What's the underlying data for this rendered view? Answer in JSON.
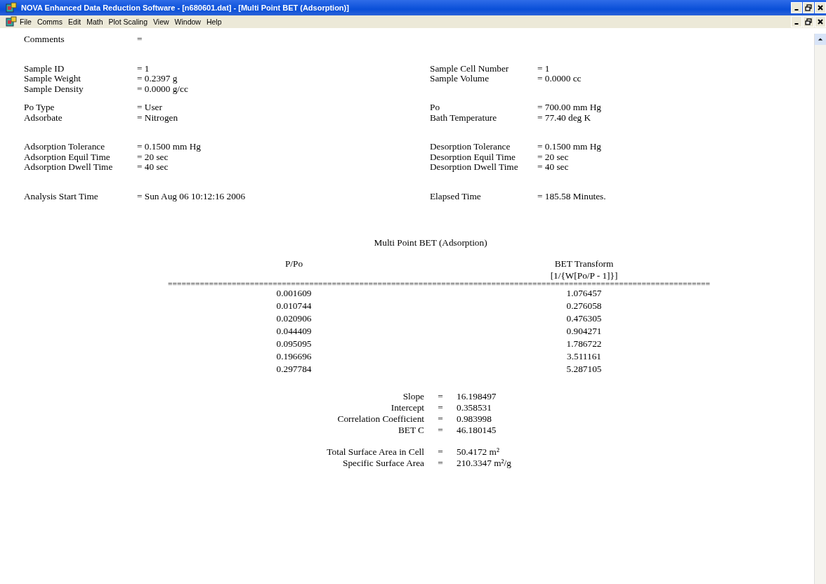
{
  "window": {
    "title": "NOVA Enhanced Data Reduction Software - [n680601.dat] - [Multi Point BET (Adsorption)]"
  },
  "menu": [
    "File",
    "Comms",
    "Edit",
    "Math",
    "Plot Scaling",
    "View",
    "Window",
    "Help"
  ],
  "parameters": [
    [
      {
        "label": "Comments",
        "value": "="
      }
    ],
    [
      {
        "label": "Sample  ID",
        "value": "= 1",
        "right_label": "Sample Cell Number",
        "right_value": "= 1"
      },
      {
        "label": "Sample Weight",
        "value": "= 0.2397 g",
        "right_label": "Sample Volume",
        "right_value": "= 0.0000 cc"
      },
      {
        "label": "Sample Density",
        "value": "= 0.0000 g/cc"
      }
    ],
    [
      {
        "label": "Po Type",
        "value": "= User",
        "right_label": "Po",
        "right_value": "= 700.00 mm Hg"
      },
      {
        "label": "Adsorbate",
        "value": "= Nitrogen",
        "right_label": "Bath Temperature",
        "right_value": "=  77.40 deg K"
      }
    ],
    [
      {
        "label": "Adsorption Tolerance",
        "value": "= 0.1500 mm Hg",
        "right_label": "Desorption Tolerance",
        "right_value": "= 0.1500 mm Hg"
      },
      {
        "label": "Adsorption Equil Time",
        "value": "= 20 sec",
        "right_label": "Desorption Equil Time",
        "right_value": "= 20 sec"
      },
      {
        "label": "Adsorption Dwell Time",
        "value": "= 40 sec",
        "right_label": "Desorption Dwell Time",
        "right_value": "= 40 sec"
      }
    ],
    [
      {
        "label": "Analysis Start Time",
        "value": "= Sun Aug 06 10:12:16 2006",
        "right_label": "Elapsed Time",
        "right_value": "= 185.58 Minutes."
      }
    ]
  ],
  "report": {
    "title": "Multi Point BET (Adsorption)",
    "columns": [
      {
        "heading": "P/Po"
      },
      {
        "heading": "BET Transform",
        "subheading": "[1/{W[Po/P - 1]}]"
      }
    ],
    "separator": "=======================================================================================================================",
    "rows": [
      [
        "0.001609",
        "1.076457"
      ],
      [
        "0.010744",
        "0.276058"
      ],
      [
        "0.020906",
        "0.476305"
      ],
      [
        "0.044409",
        "0.904271"
      ],
      [
        "0.095095",
        "1.786722"
      ],
      [
        "0.196696",
        "3.511161"
      ],
      [
        "0.297784",
        "5.287105"
      ]
    ],
    "statistics": [
      [
        {
          "label": "Slope",
          "sign": "=",
          "value": "16.198497"
        },
        {
          "label": "Intercept",
          "sign": "=",
          "value": "0.358531"
        },
        {
          "label": "Correlation Coefficient",
          "sign": "=",
          "value": "0.983998"
        },
        {
          "label": "BET C",
          "sign": "=",
          "value": "46.180145"
        }
      ],
      [
        {
          "label": "Total Surface Area in Cell",
          "sign": "=",
          "value": " 50.4172  m²"
        },
        {
          "label": "Specific Surface Area",
          "sign": "=",
          "value": "210.3347  m²/g"
        }
      ]
    ]
  }
}
